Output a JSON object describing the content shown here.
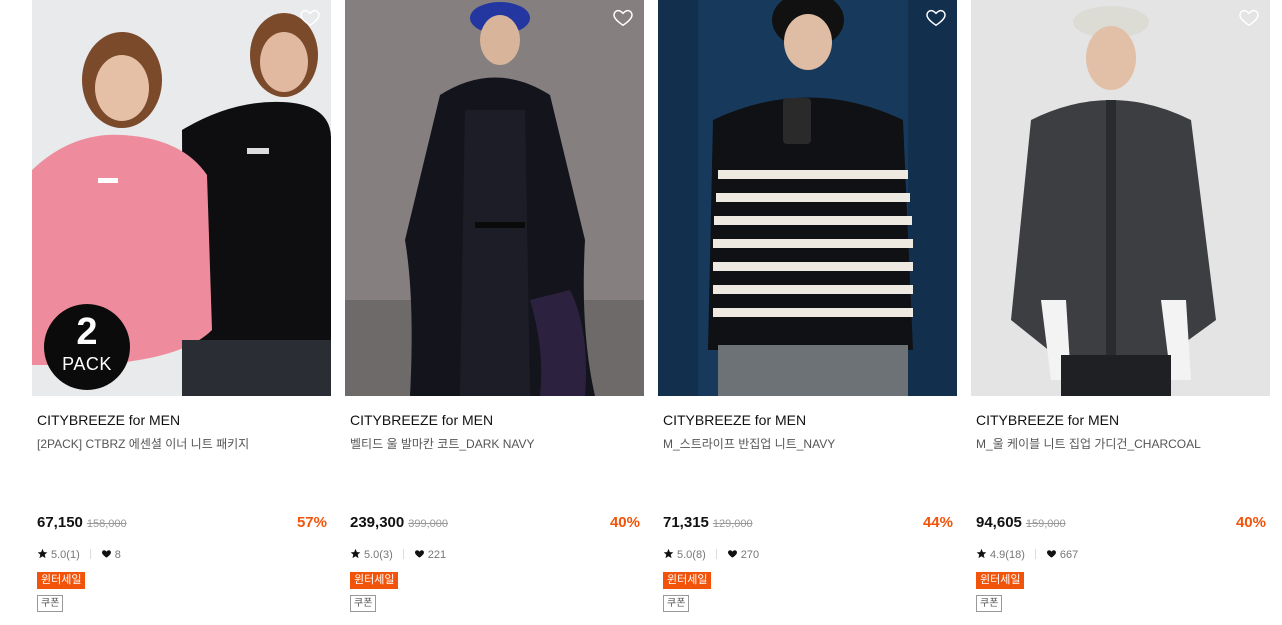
{
  "products": [
    {
      "brand": "CITYBREEZE for MEN",
      "name": "[2PACK] CTBRZ 에센셜 이너 니트 패키지",
      "price": "67,150",
      "original_price": "158,000",
      "discount": "57%",
      "rating": "5.0(1)",
      "likes": "8",
      "sale_tag": "윈터세일",
      "coupon_tag": "쿠폰",
      "badge_number": "2",
      "badge_text": "PACK",
      "image_icon": "two-models-knit-photo"
    },
    {
      "brand": "CITYBREEZE for MEN",
      "name": "벨티드 울 발마칸 코트_DARK NAVY",
      "price": "239,300",
      "original_price": "399,000",
      "discount": "40%",
      "rating": "5.0(3)",
      "likes": "221",
      "sale_tag": "윈터세일",
      "coupon_tag": "쿠폰",
      "image_icon": "navy-coat-photo"
    },
    {
      "brand": "CITYBREEZE for MEN",
      "name": "M_스트라이프 반집업 니트_NAVY",
      "price": "71,315",
      "original_price": "129,000",
      "discount": "44%",
      "rating": "5.0(8)",
      "likes": "270",
      "sale_tag": "윈터세일",
      "coupon_tag": "쿠폰",
      "image_icon": "striped-knit-photo"
    },
    {
      "brand": "CITYBREEZE for MEN",
      "name": "M_울 케이블 니트 집업 가디건_CHARCOAL",
      "price": "94,605",
      "original_price": "159,000",
      "discount": "40%",
      "rating": "4.9(18)",
      "likes": "667",
      "sale_tag": "윈터세일",
      "coupon_tag": "쿠폰",
      "image_icon": "charcoal-cardigan-photo"
    }
  ],
  "colors": {
    "accent": "#f2530a",
    "text": "#111111",
    "muted": "#999999"
  }
}
